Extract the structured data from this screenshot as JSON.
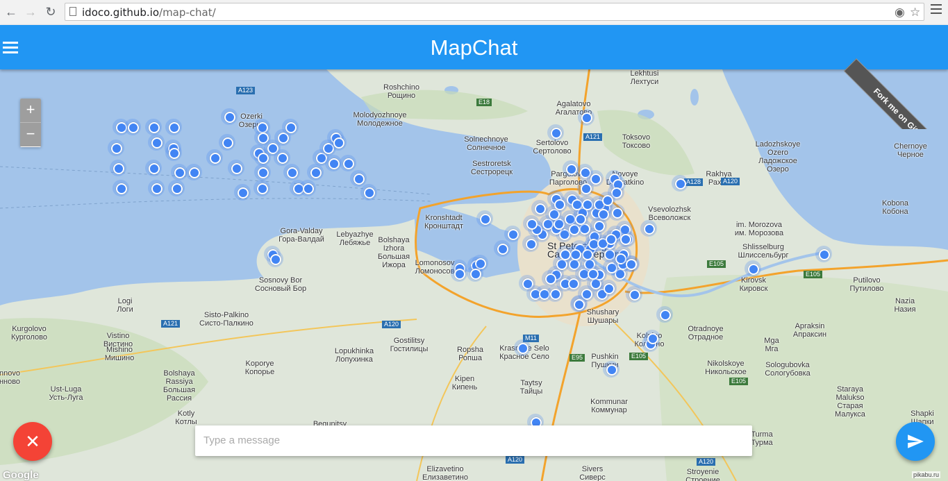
{
  "browser": {
    "url_host": "idoco.github.io",
    "url_path": "/map-chat/",
    "back_icon": "arrow-left-icon",
    "forward_icon": "arrow-right-icon",
    "reload_icon": "reload-icon"
  },
  "app": {
    "title": "MapChat",
    "ribbon": "Fork me on GitHub",
    "menu_icon": "hamburger-icon"
  },
  "map": {
    "zoom_in": "+",
    "zoom_out": "−",
    "google": "Google",
    "credit": "pikabu.ru",
    "labels": {
      "roshchino": "Roshchino\nРощино",
      "agalatovo": "Agalatovo\nАгалатово",
      "lekhtusi": "Lekhtusi\nЛехтуси",
      "ozerki": "Ozerki\nОзерки",
      "molodyozhnoye": "Molodyozhnoye\nМолодежное",
      "solnechnoye": "Solnechnoye\nСолнечное",
      "sertolovo": "Sertolovo\nСертолово",
      "toksovo": "Toksovo\nТоксово",
      "sestroretsk": "Sestroretsk\nСестрорецк",
      "pargolovo": "Pargolovo\nПарголово",
      "novoye": "Novoye\nDevyatkino",
      "ladozhskoye": "Ladozhskoye\nOzero\nЛадожское\nОзеро",
      "rakhya": "Rakhya\nРахья",
      "chernoye": "Chernoye\nЧерное",
      "kobona": "Kobona\nКобона",
      "vsevolozhsk": "Vsevolozhsk\nВсеволожск",
      "kronshtadt": "Kronshtadt\nКронштадт",
      "morozova": "im. Morozova\nим. Морозова",
      "gora_valday": "Gora-Valday\nГора-Валдай",
      "lebyazhye": "Lebyazhye\nЛебяжье",
      "bolshaya_izhora": "Bolshaya\nIzhora\nБольшая\nИжора",
      "lomonosov": "Lomonosov\nЛомоносов",
      "stpetersburg": "St Petersburg\nСанкт-Петербург",
      "shlisselburg": "Shlisselburg\nШлиссельбург",
      "sosnovy_bor": "Sosnovy Bor\nСосновый Бор",
      "kirovsk": "Kirovsk\nКировск",
      "putilovo": "Putilovo\nПутилово",
      "logi": "Logi\nЛоги",
      "nazia": "Nazia\nНазия",
      "sisto": "Sisto-Palkino\nСисто-Палкино",
      "shushary": "Shushary\nШушары",
      "otradnoye": "Otradnoye\nОтрадное",
      "kolpino": "Kolpino\nКолпино",
      "apraksin": "Apraksin\nАпраксин",
      "kurgolovo": "Kurgolovo\nКурголово",
      "vistino": "Vistino\nВистино",
      "mishino": "Mishino\nМишино",
      "gostilitsy": "Gostilitsy\nГостилицы",
      "krasnoye": "Krasnoye Selo\nКрасное Село",
      "pushkin": "Pushkin\nПушкин",
      "mga": "Mga\nМга",
      "lopukhinka": "Lopukhinka\nЛопухинка",
      "ropsha": "Ropsha\nРопша",
      "koporye": "Koporye\nКопорье",
      "nikolskoye": "Nikolskoye\nНикольское",
      "sologubovka": "Sologubovka\nСологубовка",
      "bolshaya_rassiya": "Bolshaya\nRassiya\nБольшая\nРассия",
      "kipen": "Kipen\nКипень",
      "ust_luga": "Ust-Luga\nУсть-Луга",
      "taytsy": "Taytsy\nТайцы",
      "staraya_malukso": "Staraya\nMalukso\nСтарая\nМалукса",
      "kommunar": "Kommunar\nКоммунар",
      "kotly": "Kotly\nКотлы",
      "begunitsy": "Begunitsy",
      "shapki": "Shapki\nШапки",
      "turma": "Turma\nТурма",
      "elizavetino": "Elizavetino\nЕлизаветино",
      "siversky": "Sivers\nСиверс",
      "stroyenie": "Stroyenie\nСтроение",
      "nnovo": "nnovo\nнново"
    },
    "roads": [
      "A123",
      "E18",
      "A121",
      "A120",
      "A128",
      "E105",
      "E105",
      "E95",
      "M11",
      "A121",
      "A120",
      "E105",
      "A120",
      "A120",
      "E105"
    ]
  },
  "chat": {
    "placeholder": "Type a message",
    "close_icon": "close-icon",
    "send_icon": "send-icon"
  },
  "colors": {
    "appbar": "#2196f3",
    "fab_close": "#f44336",
    "fab_send": "#2196f3",
    "marker": "#4285f4",
    "water": "#a3c4ea"
  }
}
